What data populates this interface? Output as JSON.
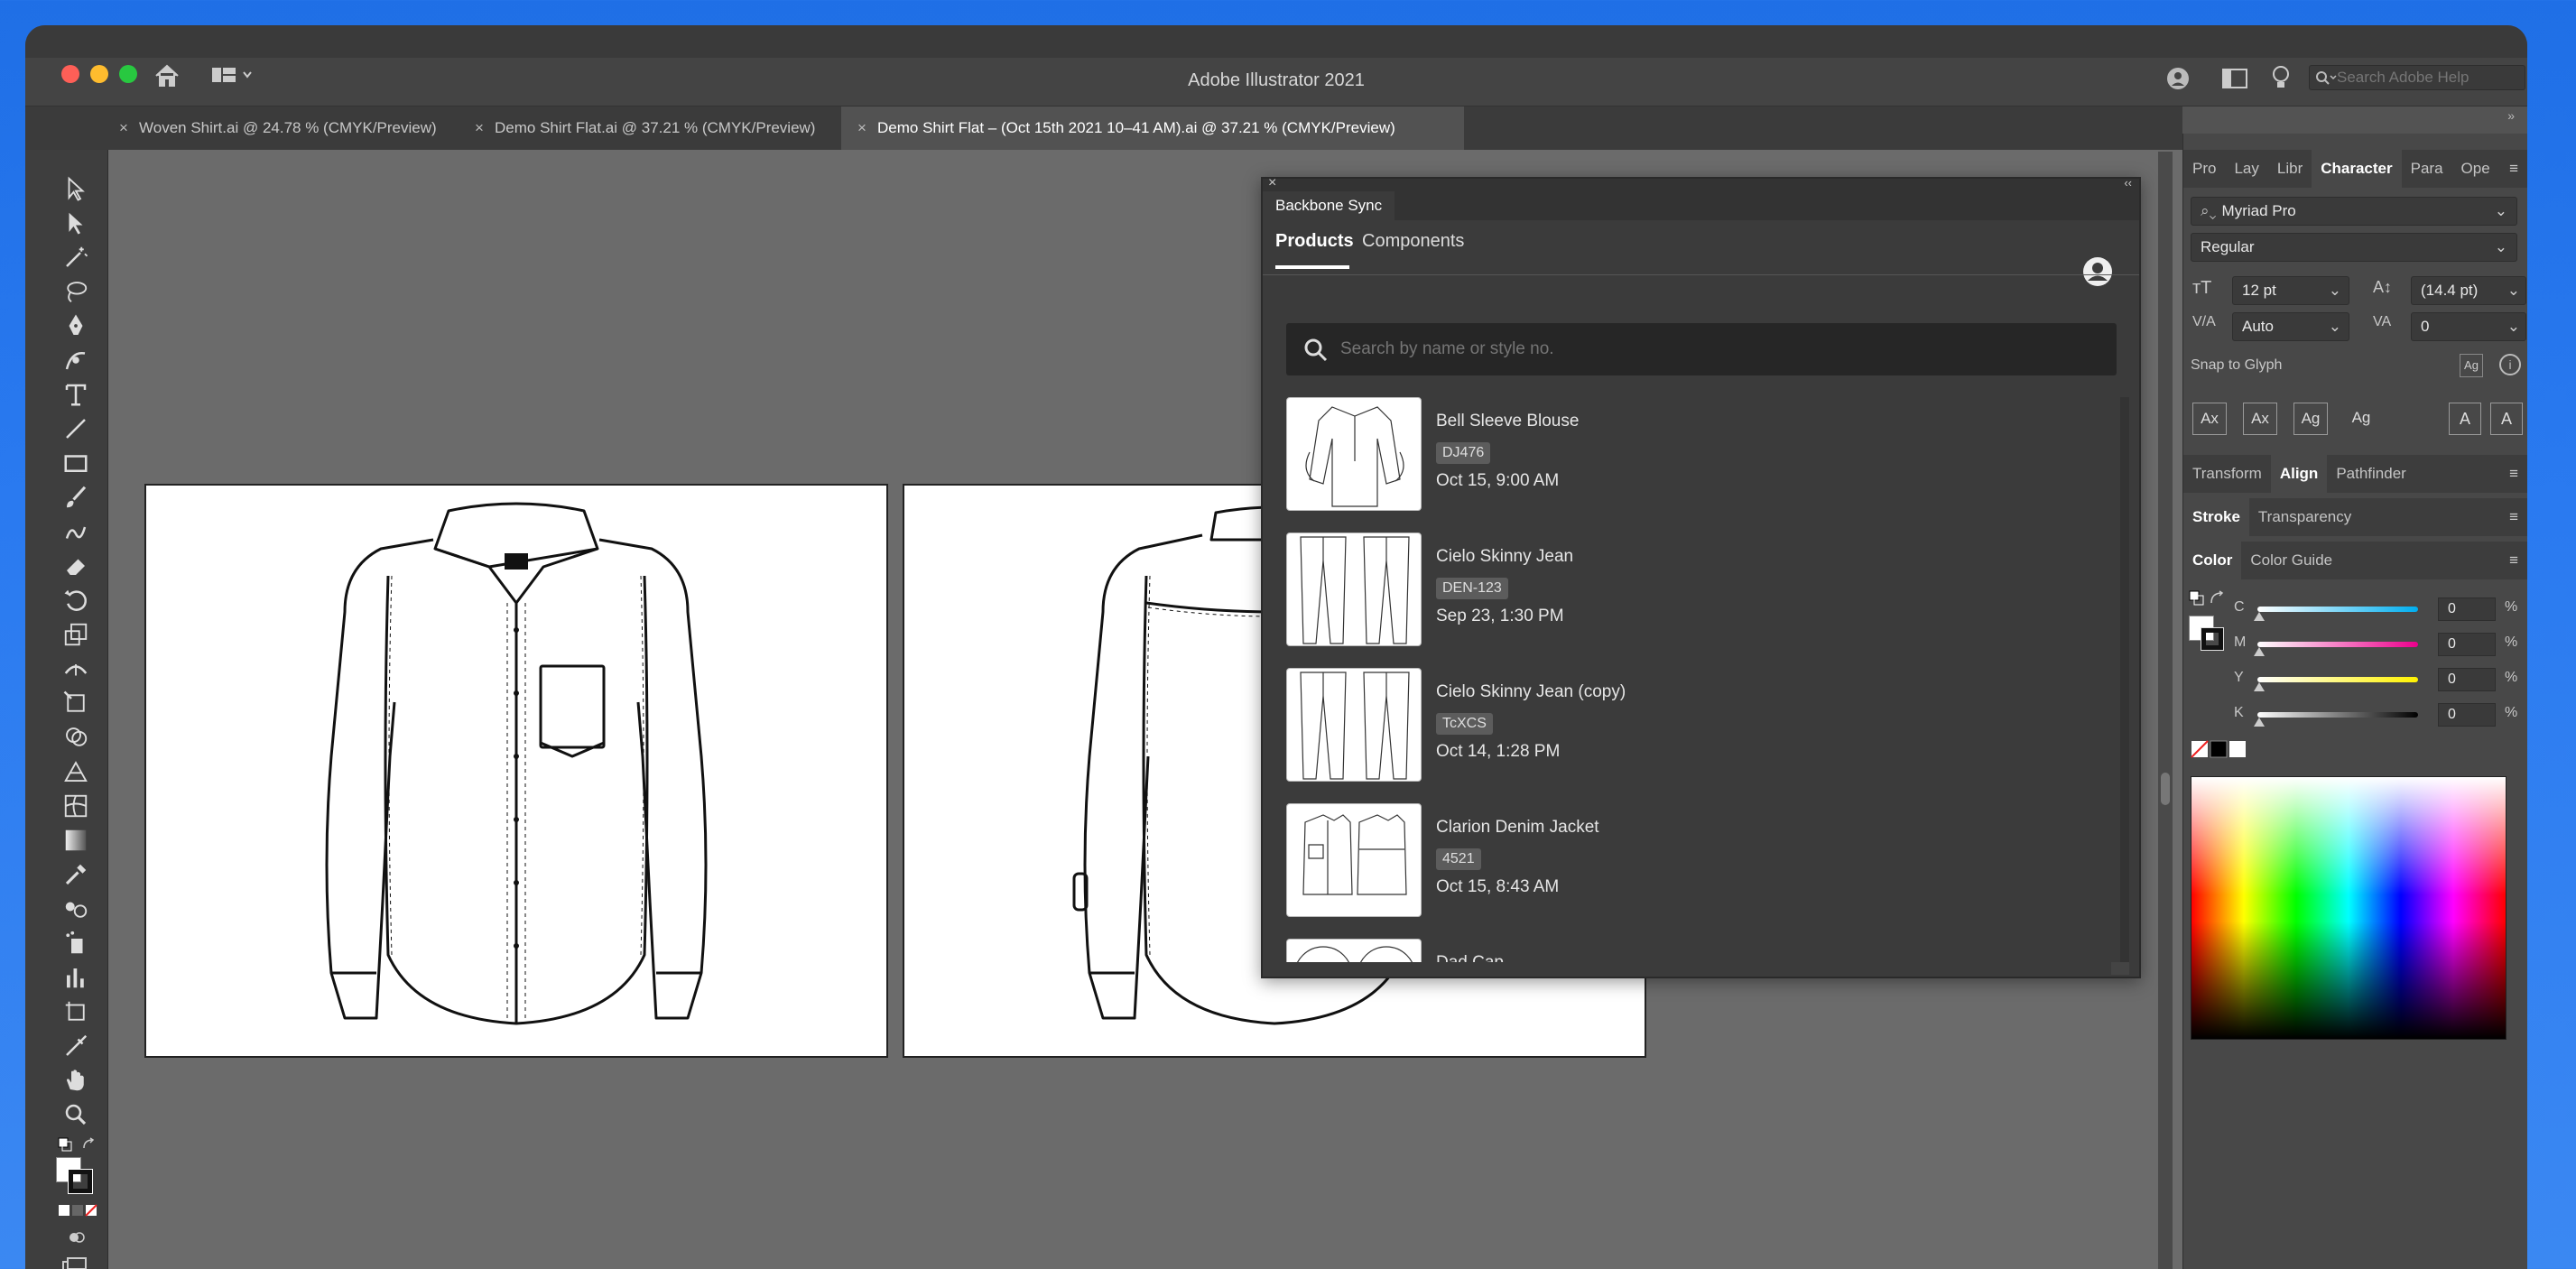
{
  "app": {
    "title": "Adobe Illustrator 2021"
  },
  "search": {
    "placeholder": "Search Adobe Help"
  },
  "tabs": [
    {
      "label": "Woven Shirt.ai @ 24.78 % (CMYK/Preview)",
      "active": false
    },
    {
      "label": "Demo Shirt Flat.ai @ 37.21 % (CMYK/Preview)",
      "active": false
    },
    {
      "label": "Demo Shirt Flat – (Oct 15th 2021 10–41 AM).ai @ 37.21 % (CMYK/Preview)",
      "active": true
    }
  ],
  "backbone": {
    "header": "Backbone Sync",
    "tab_products": "Products",
    "tab_components": "Components",
    "search_placeholder": "Search by name or style no.",
    "products": [
      {
        "name": "Bell Sleeve Blouse",
        "code": "DJ476",
        "date": "Oct 15, 9:00 AM"
      },
      {
        "name": "Cielo Skinny Jean",
        "code": "DEN-123",
        "date": "Sep 23, 1:30 PM"
      },
      {
        "name": "Cielo Skinny Jean (copy)",
        "code": "TcXCS",
        "date": "Oct 14, 1:28 PM"
      },
      {
        "name": "Clarion Denim Jacket",
        "code": "4521",
        "date": "Oct 15, 8:43 AM"
      },
      {
        "name": "Dad Cap",
        "code": "",
        "date": ""
      }
    ]
  },
  "character": {
    "tabs": [
      "Pro",
      "Lay",
      "Libr",
      "Character",
      "Para",
      "Ope"
    ],
    "font": "Myriad Pro",
    "style": "Regular",
    "size": "12 pt",
    "leading": "(14.4 pt)",
    "kerning": "Auto",
    "tracking": "0",
    "snap_label": "Snap to Glyph"
  },
  "panels": {
    "transform": "Transform",
    "align": "Align",
    "pathfinder": "Pathfinder",
    "stroke": "Stroke",
    "transparency": "Transparency",
    "color": "Color",
    "color_guide": "Color Guide"
  },
  "color": {
    "channels": [
      {
        "label": "C",
        "value": "0",
        "gradient": [
          "#ffffff",
          "#00aeef"
        ]
      },
      {
        "label": "M",
        "value": "0",
        "gradient": [
          "#ffffff",
          "#ec008c"
        ]
      },
      {
        "label": "Y",
        "value": "0",
        "gradient": [
          "#ffffff",
          "#fff200"
        ]
      },
      {
        "label": "K",
        "value": "0",
        "gradient": [
          "#ffffff",
          "#000000"
        ]
      }
    ],
    "unit": "%"
  }
}
